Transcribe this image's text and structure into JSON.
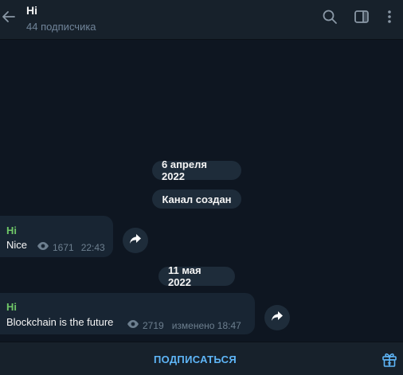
{
  "header": {
    "title": "Hi",
    "subtitle": "44 подписчика",
    "icons": [
      "back-arrow-icon",
      "search-icon",
      "sidebar-toggle-icon",
      "more-vertical-icon"
    ]
  },
  "chat": {
    "date_1": "6 апреля 2022",
    "service_1": "Канал создан",
    "message_1": {
      "author": "Hi",
      "text": "Nice",
      "views": "1671",
      "time": "22:43"
    },
    "date_2": "11 мая 2022",
    "message_2": {
      "author": "Hi",
      "text": "Blockchain is the future",
      "views": "2719",
      "edited_time": "изменено 18:47"
    }
  },
  "footer": {
    "subscribe_label": "ПОДПИСАТЬСЯ",
    "icon": "gift-icon"
  },
  "colors": {
    "background": "#0e1621",
    "header": "#17212b",
    "bubble": "#182533",
    "author": "#6fc768",
    "accent": "#5eb5f7",
    "muted": "#708499"
  }
}
